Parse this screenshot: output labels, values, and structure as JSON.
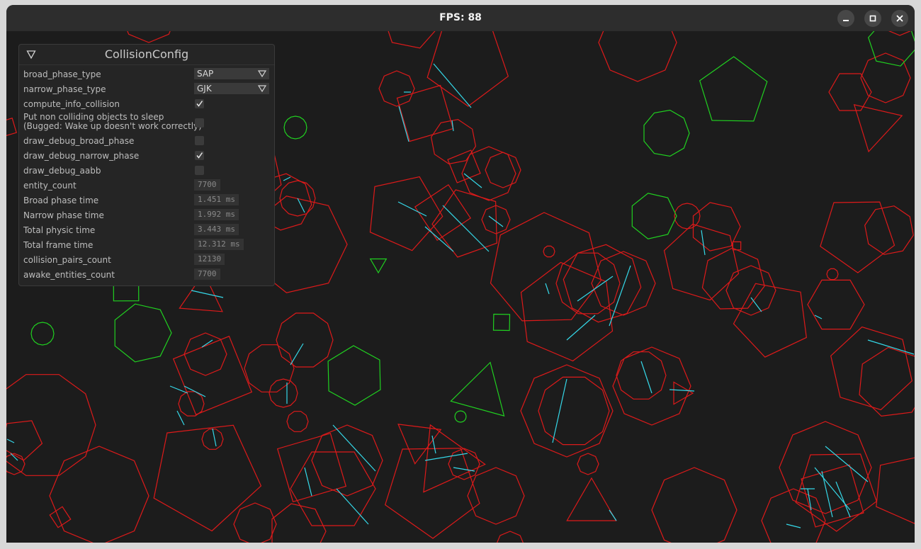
{
  "window": {
    "title": "FPS: 88"
  },
  "window_controls": {
    "minimize": "minimize-icon",
    "maximize": "maximize-icon",
    "close": "close-icon"
  },
  "colors": {
    "colliding": "#dd1a1a",
    "free": "#20d020",
    "contact": "#35d8e8",
    "background": "#1c1c1c",
    "panel": "#252525"
  },
  "panel": {
    "title": "CollisionConfig",
    "broad_phase_type": {
      "label": "broad_phase_type",
      "value": "SAP"
    },
    "narrow_phase_type": {
      "label": "narrow_phase_type",
      "value": "GJK"
    },
    "compute_info_collision": {
      "label": "compute_info_collision",
      "checked": true
    },
    "sleep": {
      "label_line1": "Put non colliding objects to sleep",
      "label_line2": "(Bugged: Wake up doesn't work correctly)",
      "checked": false
    },
    "draw_debug_broad_phase": {
      "label": "draw_debug_broad_phase",
      "checked": false
    },
    "draw_debug_narrow_phase": {
      "label": "draw_debug_narrow_phase",
      "checked": true
    },
    "draw_debug_aabb": {
      "label": "draw_debug_aabb",
      "checked": false
    },
    "entity_count": {
      "label": "entity_count",
      "value": "7700"
    },
    "broad_phase_time": {
      "label": "Broad phase time",
      "value": "1.451 ms"
    },
    "narrow_phase_time": {
      "label": "Narrow phase time",
      "value": "1.992 ms"
    },
    "total_physic_time": {
      "label": "Total physic time",
      "value": "3.443 ms"
    },
    "total_frame_time": {
      "label": "Total frame time",
      "value": "12.312 ms"
    },
    "collision_pairs_count": {
      "label": "collision_pairs_count",
      "value": "12130"
    },
    "awake_entities_count": {
      "label": "awake_entities_count",
      "value": "7700"
    }
  }
}
